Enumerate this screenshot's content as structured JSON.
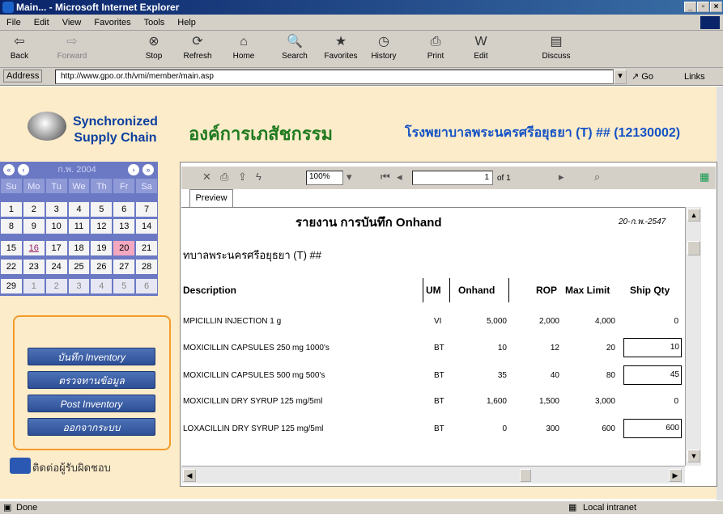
{
  "window": {
    "title": "Main... - Microsoft Internet Explorer",
    "controls": [
      "_",
      "▫",
      "×"
    ]
  },
  "menubar": [
    "File",
    "Edit",
    "View",
    "Favorites",
    "Tools",
    "Help"
  ],
  "toolbar": {
    "back": "Back",
    "forward": "Forward",
    "stop": "Stop",
    "refresh": "Refresh",
    "home": "Home",
    "search": "Search",
    "favorites": "Favorites",
    "history": "History",
    "print": "Print",
    "edit": "Edit",
    "discuss": "Discuss"
  },
  "address": {
    "label": "Address",
    "url": "http://www.gpo.or.th/vmi/member/main.asp",
    "go": "Go",
    "links": "Links"
  },
  "header": {
    "logo_line1": "Synchronized",
    "logo_line2": "Supply Chain",
    "org": "องค์การเภสัชกรรม",
    "hospital": "โรงพยาบาลพระนครศรีอยุธยา (T) ## (12130002)"
  },
  "calendar": {
    "month": "ก.พ. 2004",
    "dows": [
      "Su",
      "Mo",
      "Tu",
      "We",
      "Th",
      "Fr",
      "Sa"
    ],
    "weeks": [
      [
        "1",
        "2",
        "3",
        "4",
        "5",
        "6",
        "7"
      ],
      [
        "8",
        "9",
        "10",
        "11",
        "12",
        "13",
        "14"
      ],
      [
        "15",
        "16",
        "17",
        "18",
        "19",
        "20",
        "21"
      ],
      [
        "22",
        "23",
        "24",
        "25",
        "26",
        "27",
        "28"
      ],
      [
        "29",
        "1",
        "2",
        "3",
        "4",
        "5",
        "6"
      ]
    ]
  },
  "menu": {
    "inventory": "บันทึก Inventory",
    "verify": "ตรวจทานข้อมูล",
    "post": "Post Inventory",
    "logout": "ออกจากระบบ"
  },
  "contact": "ติดต่อผู้รับผิดชอบ",
  "viewer": {
    "zoom": "100%",
    "page": "1",
    "page_of": "of 1",
    "tab": "Preview"
  },
  "report": {
    "title": "รายงาน การบันทึก Onhand",
    "date": "20-ก.พ.-2547",
    "subtitle": "ทบาลพระนครศรีอยุธยา (T) ##",
    "columns": [
      "Description",
      "UM",
      "Onhand",
      "ROP",
      "Max Limit",
      "Ship Qty"
    ],
    "rows": [
      [
        "MPICILLIN INJECTION 1 g",
        "VI",
        "5,000",
        "2,000",
        "4,000",
        "0"
      ],
      [
        "MOXICILLIN CAPSULES 250 mg 1000's",
        "BT",
        "10",
        "12",
        "20",
        "10"
      ],
      [
        "MOXICILLIN CAPSULES 500 mg 500's",
        "BT",
        "35",
        "40",
        "80",
        "45"
      ],
      [
        "MOXICILLIN DRY SYRUP 125 mg/5ml",
        "BT",
        "1,600",
        "1,500",
        "3,000",
        "0"
      ],
      [
        "LOXACILLIN DRY SYRUP 125 mg/5ml",
        "BT",
        "0",
        "300",
        "600",
        "600"
      ]
    ]
  },
  "status": {
    "left": "Done",
    "zone": "Local intranet"
  }
}
